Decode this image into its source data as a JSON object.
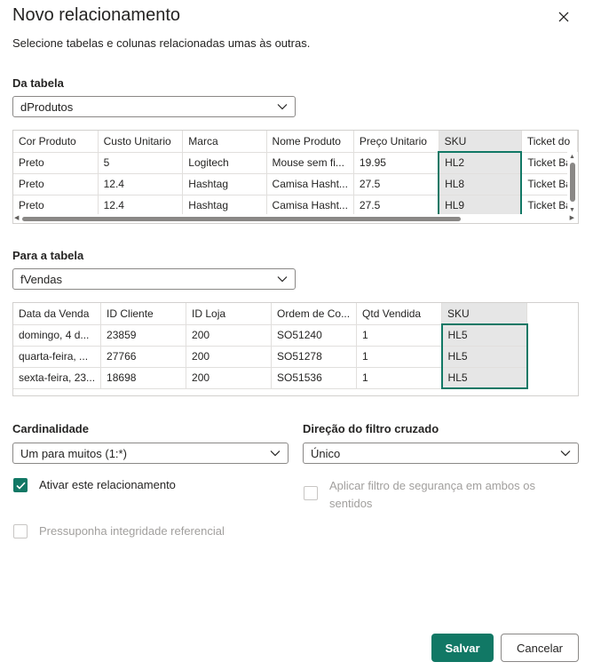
{
  "dialog": {
    "title": "Novo relacionamento",
    "subtitle": "Selecione tabelas e colunas relacionadas umas às outras."
  },
  "from_table": {
    "label": "Da tabela",
    "selected": "dProdutos",
    "columns": [
      "Cor Produto",
      "Custo Unitario",
      "Marca",
      "Nome Produto",
      "Preço Unitario",
      "SKU",
      "Ticket do"
    ],
    "rows": [
      [
        "Preto",
        "5",
        "Logitech",
        "Mouse sem fi...",
        "19.95",
        "HL2",
        "Ticket Ba"
      ],
      [
        "Preto",
        "12.4",
        "Hashtag",
        "Camisa Hasht...",
        "27.5",
        "HL8",
        "Ticket Ba"
      ],
      [
        "Preto",
        "12.4",
        "Hashtag",
        "Camisa Hasht...",
        "27.5",
        "HL9",
        "Ticket Ba"
      ]
    ],
    "selected_column": "SKU"
  },
  "to_table": {
    "label": "Para a tabela",
    "selected": "fVendas",
    "columns": [
      "Data da Venda",
      "ID Cliente",
      "ID Loja",
      "Ordem de Co...",
      "Qtd Vendida",
      "SKU"
    ],
    "rows": [
      [
        "domingo, 4 d...",
        "23859",
        "200",
        "SO51240",
        "1",
        "HL5"
      ],
      [
        "quarta-feira, ...",
        "27766",
        "200",
        "SO51278",
        "1",
        "HL5"
      ],
      [
        "sexta-feira, 23...",
        "18698",
        "200",
        "SO51536",
        "1",
        "HL5"
      ]
    ],
    "selected_column": "SKU"
  },
  "cardinality": {
    "label": "Cardinalidade",
    "selected": "Um para muitos (1:*)"
  },
  "cross_filter": {
    "label": "Direção do filtro cruzado",
    "selected": "Único"
  },
  "options": {
    "activate": {
      "label": "Ativar este relacionamento",
      "checked": true
    },
    "security_filter": {
      "label_line1": "Aplicar filtro de segurança em ambos os",
      "label_line2": "sentidos",
      "checked": false,
      "disabled": true
    },
    "referential": {
      "label": "Pressuponha integridade referencial",
      "checked": false,
      "disabled": true
    }
  },
  "buttons": {
    "save": "Salvar",
    "cancel": "Cancelar"
  },
  "colors": {
    "accent": "#117865",
    "selected_column_bg": "#e6e6e6",
    "border": "#8a8886"
  }
}
